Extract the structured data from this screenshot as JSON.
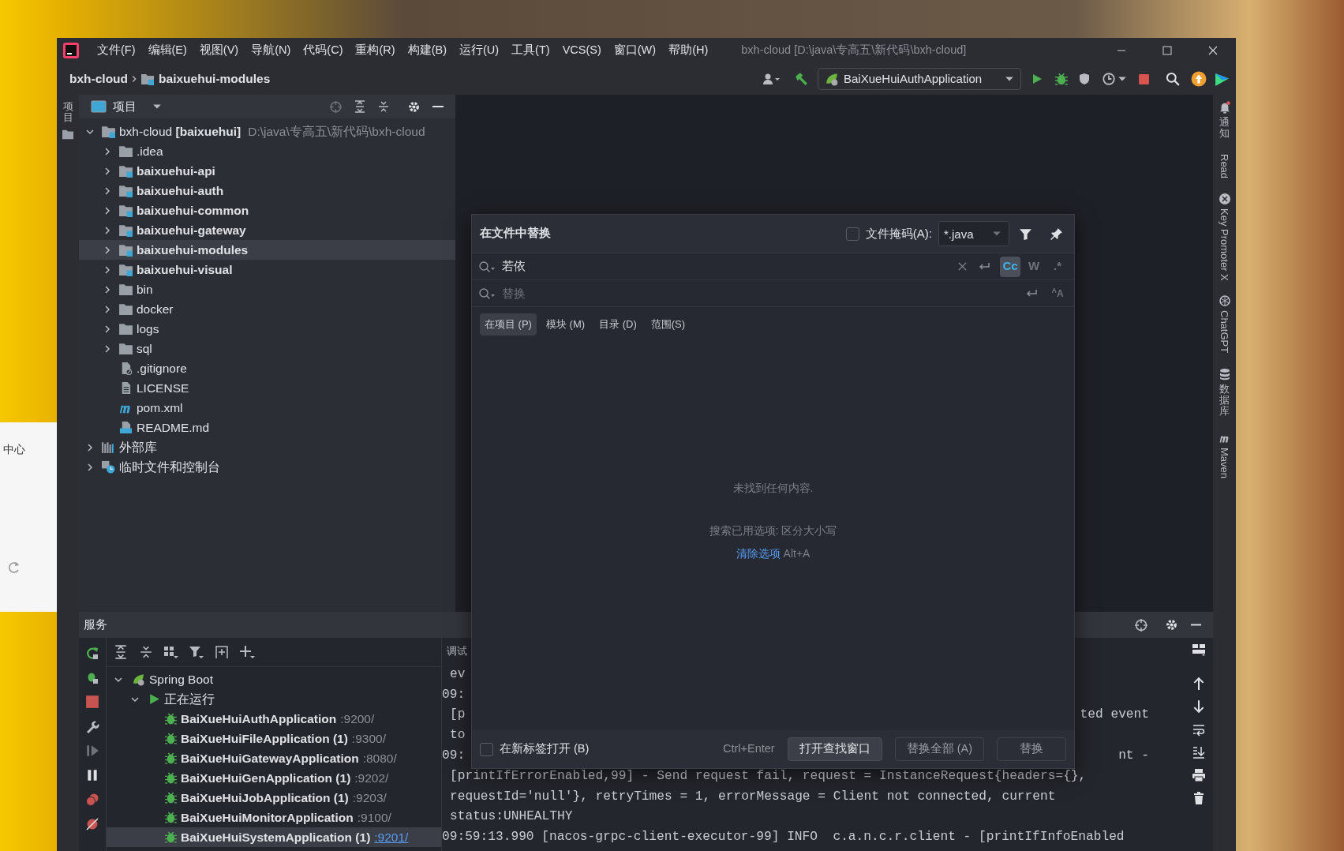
{
  "desktop": {
    "background_window_text": "中心"
  },
  "window": {
    "title": "bxh-cloud [D:\\java\\专高五\\新代码\\bxh-cloud]",
    "menu": [
      "文件(F)",
      "编辑(E)",
      "视图(V)",
      "导航(N)",
      "代码(C)",
      "重构(R)",
      "构建(B)",
      "运行(U)",
      "工具(T)",
      "VCS(S)",
      "窗口(W)",
      "帮助(H)"
    ]
  },
  "navigation_bar": {
    "breadcrumbs": [
      "bxh-cloud",
      "baixuehui-modules"
    ],
    "run_configuration": "BaiXueHuiAuthApplication"
  },
  "left_tool_strip": {
    "label": "项目"
  },
  "project_panel": {
    "title": "项目",
    "tree": [
      {
        "label": "bxh-cloud",
        "module_name": "[baixuehui]",
        "path": "D:\\java\\专高五\\新代码\\bxh-cloud",
        "kind": "project_root",
        "expanded": true,
        "selected": false,
        "children": [
          {
            "label": ".idea",
            "kind": "folder",
            "expanded": false,
            "selected": false
          },
          {
            "label": "baixuehui-api",
            "kind": "module",
            "expanded": false,
            "selected": false
          },
          {
            "label": "baixuehui-auth",
            "kind": "module",
            "expanded": false,
            "selected": false
          },
          {
            "label": "baixuehui-common",
            "kind": "module",
            "expanded": false,
            "selected": false
          },
          {
            "label": "baixuehui-gateway",
            "kind": "module",
            "expanded": false,
            "selected": false
          },
          {
            "label": "baixuehui-modules",
            "kind": "module",
            "expanded": false,
            "selected": true
          },
          {
            "label": "baixuehui-visual",
            "kind": "module",
            "expanded": false,
            "selected": false
          },
          {
            "label": "bin",
            "kind": "folder",
            "expanded": false,
            "selected": false
          },
          {
            "label": "docker",
            "kind": "folder",
            "expanded": false,
            "selected": false
          },
          {
            "label": "logs",
            "kind": "folder",
            "expanded": false,
            "selected": false
          },
          {
            "label": "sql",
            "kind": "folder",
            "expanded": false,
            "selected": false
          },
          {
            "label": ".gitignore",
            "kind": "ignore_file",
            "selected": false
          },
          {
            "label": "LICENSE",
            "kind": "text_file",
            "selected": false
          },
          {
            "label": "pom.xml",
            "kind": "maven_file",
            "selected": false
          },
          {
            "label": "README.md",
            "kind": "markdown_file",
            "selected": false
          }
        ]
      },
      {
        "label": "外部库",
        "kind": "libraries",
        "expanded": false,
        "selected": false
      },
      {
        "label": "临时文件和控制台",
        "kind": "scratches",
        "expanded": false,
        "selected": false
      }
    ]
  },
  "right_tool_strip": [
    {
      "label": "通知",
      "kind": "notifications"
    },
    {
      "label": "Read",
      "kind": "read"
    },
    {
      "label": "Key Promoter X",
      "kind": "key_promoter"
    },
    {
      "label": "ChatGPT",
      "kind": "chatgpt"
    },
    {
      "label": "数据库",
      "kind": "database"
    },
    {
      "label": "Maven",
      "kind": "maven"
    }
  ],
  "replace_dialog": {
    "title": "在文件中替换",
    "file_mask": {
      "label": "文件掩码(A):",
      "checked": false,
      "value": "*.java"
    },
    "search": {
      "value": "若依",
      "options": [
        {
          "label": "Cc",
          "selected": true
        },
        {
          "label": "W",
          "selected": false
        },
        {
          "label": ".*",
          "selected": false
        }
      ]
    },
    "replace": {
      "placeholder": "替换",
      "options": [
        {
          "label": "$^{A}$A",
          "selected": false
        }
      ]
    },
    "scopes": [
      {
        "label": "在项目 (P)",
        "selected": true
      },
      {
        "label": "模块 (M)",
        "selected": false
      },
      {
        "label": "目录 (D)",
        "selected": false
      },
      {
        "label": "范围(S)",
        "selected": false
      }
    ],
    "empty_message": "未找到任何内容.",
    "options_note": "搜索已用选项: 区分大小写",
    "clear_link": "清除选项",
    "clear_shortcut": "Alt+A",
    "open_in_new_tab": {
      "label": "在新标签打开 (B)",
      "checked": false
    },
    "shortcut": "Ctrl+Enter",
    "buttons": [
      {
        "label": "打开查找窗口",
        "default": true
      },
      {
        "label": "替换全部 (A)",
        "default": false
      },
      {
        "label": "替换",
        "default": false
      }
    ]
  },
  "services": {
    "title": "服务",
    "tree": [
      {
        "label": "Spring Boot",
        "expanded": true,
        "children": [
          {
            "label": "正在运行",
            "expanded": true,
            "children": [
              {
                "label": "BaiXueHuiAuthApplication",
                "port": ":9200/",
                "selected": false
              },
              {
                "label": "BaiXueHuiFileApplication (1)",
                "port": ":9300/",
                "selected": false
              },
              {
                "label": "BaiXueHuiGatewayApplication",
                "port": ":8080/",
                "selected": false
              },
              {
                "label": "BaiXueHuiGenApplication (1)",
                "port": ":9202/",
                "selected": false
              },
              {
                "label": "BaiXueHuiJobApplication (1)",
                "port": ":9203/",
                "selected": false
              },
              {
                "label": "BaiXueHuiMonitorApplication",
                "port": ":9100/",
                "selected": false
              },
              {
                "label": "BaiXueHuiSystemApplication (1)",
                "port": ":9201/",
                "selected": true
              }
            ]
          }
        ]
      }
    ],
    "console": {
      "tab": "调试",
      "lines": [
        {
          "kind": "continuation",
          "text": "ev"
        },
        {
          "kind": "start",
          "text": "09:"
        },
        {
          "kind": "continuation",
          "text": "[p",
          "right": "ted event"
        },
        {
          "kind": "continuation",
          "text": "to"
        },
        {
          "kind": "start",
          "text": "09:",
          "right": "nt -"
        },
        {
          "kind": "continuation",
          "text": "[printIfErrorEnabled,99] - Send request fail, request = InstanceRequest{headers={},"
        },
        {
          "kind": "continuation",
          "text": "requestId='null'}, retryTimes = 1, errorMessage = Client not connected, current"
        },
        {
          "kind": "continuation",
          "text": "status:UNHEALTHY"
        },
        {
          "kind": "start",
          "text": "09:59:13.990 [nacos-grpc-client-executor-99] INFO  c.a.n.c.r.client - [printIfInfoEnabled"
        }
      ]
    }
  }
}
